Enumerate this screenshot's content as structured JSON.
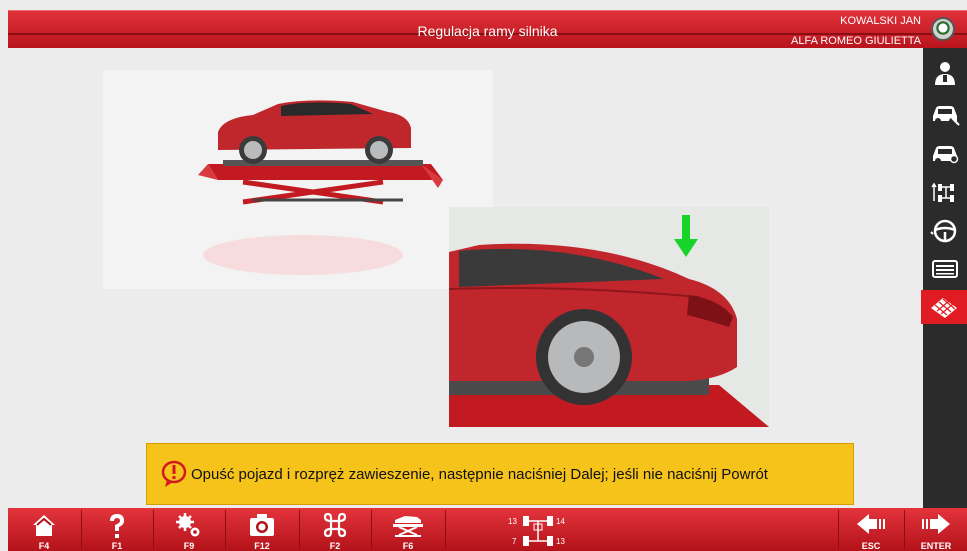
{
  "header": {
    "title": "Regulacja ramy silnika",
    "user": "KOWALSKI JAN",
    "vehicle": "ALFA ROMEO GIULIETTA",
    "logo": "alfa-romeo-logo"
  },
  "sidebar": {
    "items": [
      {
        "icon": "technician-icon"
      },
      {
        "icon": "car-wrench-icon"
      },
      {
        "icon": "car-search-icon"
      },
      {
        "icon": "axle-adjust-icon"
      },
      {
        "icon": "steering-wheel-icon"
      },
      {
        "icon": "keyboard-icon"
      },
      {
        "icon": "alignment-grid-icon",
        "active": true
      }
    ]
  },
  "main": {
    "image_lift": "car-on-scissor-lift-image",
    "image_rear": "car-rear-suspension-image"
  },
  "message": {
    "icon": "warning-icon",
    "text": "Opuść pojazd i rozpręż zawieszenie, następnie naciśniej Dalej; jeśli nie naciśnij Powrót"
  },
  "toolbar": {
    "buttons": [
      {
        "icon": "home-icon",
        "key": "F4"
      },
      {
        "icon": "help-icon",
        "key": "F1"
      },
      {
        "icon": "settings-icon",
        "key": "F9"
      },
      {
        "icon": "camera-icon",
        "key": "F12"
      },
      {
        "icon": "command-icon",
        "key": "F2"
      },
      {
        "icon": "lift-icon",
        "key": "F6"
      }
    ],
    "axis": {
      "tl": "13",
      "tr": "14",
      "bl": "7",
      "br": "13"
    },
    "back": {
      "icon": "arrow-left-icon",
      "key": "ESC"
    },
    "next": {
      "icon": "arrow-right-icon",
      "key": "ENTER"
    }
  },
  "colors": {
    "accent": "#d9222a",
    "sidebar": "#2b2b2b",
    "message_bg": "#f6c31b"
  }
}
